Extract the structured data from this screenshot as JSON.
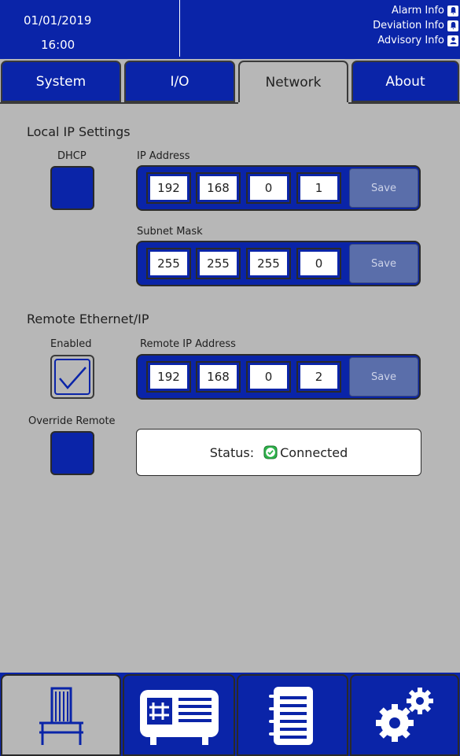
{
  "header": {
    "date": "01/01/2019",
    "time": "16:00",
    "alarms": [
      {
        "label": "Alarm Info",
        "icon": "bell-icon"
      },
      {
        "label": "Deviation Info",
        "icon": "bell-icon"
      },
      {
        "label": "Advisory Info",
        "icon": "person-icon"
      }
    ]
  },
  "tabs": [
    {
      "label": "System",
      "active": false
    },
    {
      "label": "I/O",
      "active": false
    },
    {
      "label": "Network",
      "active": true
    },
    {
      "label": "About",
      "active": false
    }
  ],
  "local": {
    "title": "Local IP Settings",
    "dhcp_label": "DHCP",
    "dhcp_checked": false,
    "ip_label": "IP Address",
    "ip": [
      "192",
      "168",
      "0",
      "1"
    ],
    "mask_label": "Subnet Mask",
    "mask": [
      "255",
      "255",
      "255",
      "0"
    ],
    "save_label": "Save"
  },
  "remote": {
    "title": "Remote Ethernet/IP",
    "enabled_label": "Enabled",
    "enabled_checked": true,
    "ip_label": "Remote IP Address",
    "ip": [
      "192",
      "168",
      "0",
      "2"
    ],
    "save_label": "Save",
    "override_label": "Override Remote",
    "override_checked": false,
    "status_label": "Status:",
    "status_value": "Connected",
    "status_icon": "check-circle-icon"
  },
  "nav": [
    {
      "name": "machine-icon",
      "active": true
    },
    {
      "name": "controller-icon",
      "active": false
    },
    {
      "name": "log-icon",
      "active": false
    },
    {
      "name": "settings-gears-icon",
      "active": false
    }
  ],
  "colors": {
    "primary_blue": "#0a24a8",
    "background_gray": "#b7b7b7",
    "save_disabled": "#5a6eaa",
    "status_ok": "#2db24a"
  }
}
